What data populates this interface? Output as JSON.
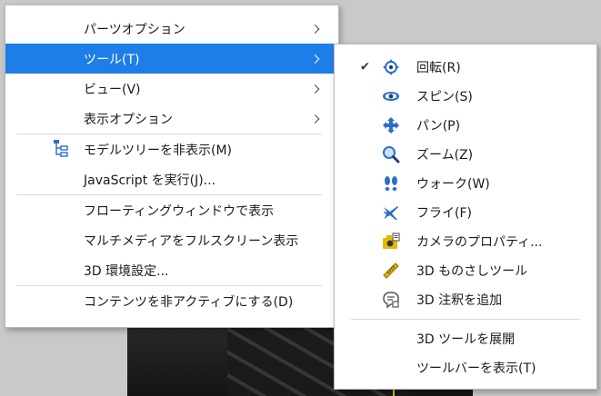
{
  "main_menu": {
    "items": [
      {
        "label": "パーツオプション",
        "submenu": true
      },
      {
        "label": "ツール(T)",
        "submenu": true,
        "highlighted": true
      },
      {
        "label": "ビュー(V)",
        "submenu": true
      },
      {
        "label": "表示オプション",
        "submenu": true
      },
      {
        "label": "モデルツリーを非表示(M)",
        "icon": "model-tree-icon"
      },
      {
        "label": "JavaScript を実行(J)..."
      },
      {
        "label": "フローティングウィンドウで表示"
      },
      {
        "label": "マルチメディアをフルスクリーン表示"
      },
      {
        "label": "3D 環境設定..."
      },
      {
        "label": "コンテンツを非アクティブにする(D)"
      }
    ]
  },
  "tools_menu": {
    "items": [
      {
        "label": "回転(R)",
        "icon": "rotate-icon",
        "checked": true
      },
      {
        "label": "スピン(S)",
        "icon": "spin-icon"
      },
      {
        "label": "パン(P)",
        "icon": "pan-icon"
      },
      {
        "label": "ズーム(Z)",
        "icon": "zoom-icon"
      },
      {
        "label": "ウォーク(W)",
        "icon": "walk-icon"
      },
      {
        "label": "フライ(F)",
        "icon": "fly-icon"
      },
      {
        "label": "カメラのプロパティ...",
        "icon": "camera-properties-icon"
      },
      {
        "label": "3D ものさしツール",
        "icon": "ruler-icon"
      },
      {
        "label": "3D 注釈を追加",
        "icon": "comment-icon"
      },
      {
        "label": "3D ツールを展開"
      },
      {
        "label": "ツールバーを表示(T)"
      }
    ]
  },
  "colors": {
    "highlight": "#1e7ee8",
    "icon_blue": "#2d6fc8",
    "icon_yellow": "#e8b800"
  }
}
